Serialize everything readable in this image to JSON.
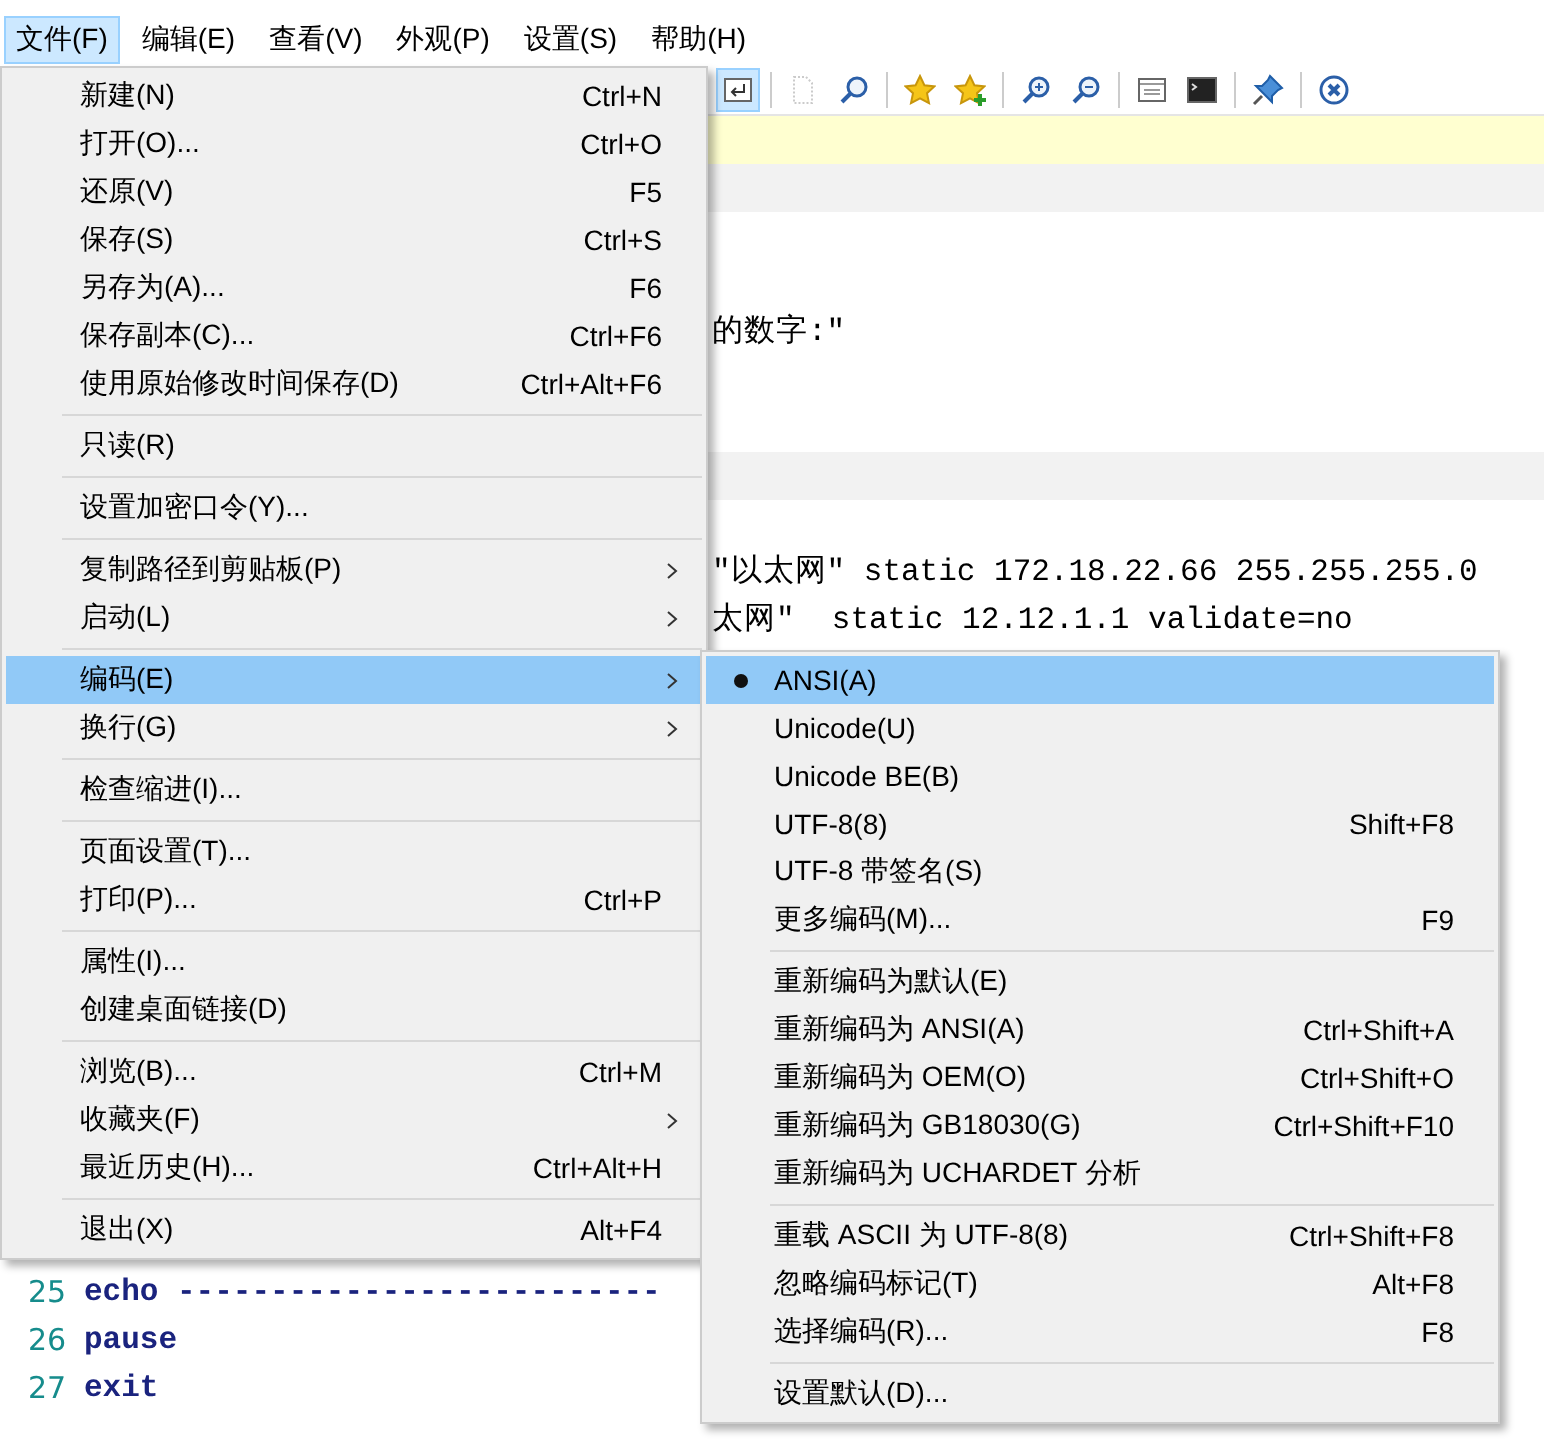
{
  "menubar": [
    {
      "label": "文件(F)",
      "selected": true
    },
    {
      "label": "编辑(E)",
      "selected": false
    },
    {
      "label": "查看(V)",
      "selected": false
    },
    {
      "label": "外观(P)",
      "selected": false
    },
    {
      "label": "设置(S)",
      "selected": false
    },
    {
      "label": "帮助(H)",
      "selected": false
    }
  ],
  "toolbar": [
    {
      "kind": "wrap",
      "pressed": true,
      "disabled": false
    },
    {
      "kind": "sep"
    },
    {
      "kind": "doc",
      "pressed": false,
      "disabled": true
    },
    {
      "kind": "find",
      "pressed": false,
      "disabled": false
    },
    {
      "kind": "sep"
    },
    {
      "kind": "star",
      "pressed": false,
      "disabled": false
    },
    {
      "kind": "star-add",
      "pressed": false,
      "disabled": false
    },
    {
      "kind": "sep"
    },
    {
      "kind": "zoom-in",
      "pressed": false,
      "disabled": false
    },
    {
      "kind": "zoom-out",
      "pressed": false,
      "disabled": false
    },
    {
      "kind": "sep"
    },
    {
      "kind": "window",
      "pressed": false,
      "disabled": false
    },
    {
      "kind": "terminal",
      "pressed": false,
      "disabled": false
    },
    {
      "kind": "sep"
    },
    {
      "kind": "pin",
      "pressed": false,
      "disabled": false
    },
    {
      "kind": "sep"
    },
    {
      "kind": "close",
      "pressed": false,
      "disabled": false
    }
  ],
  "editor": {
    "lines": [
      {
        "kind": "covered",
        "text": "的数字:\""
      },
      {
        "kind": "covered",
        "text": "\"以太网\" static 172.18.22.66 255.255.255.0"
      },
      {
        "kind": "covered",
        "text": "太网\"  static 12.12.1.1 validate=no"
      },
      {
        "kind": "code",
        "number": "25",
        "text": "echo --------------------------"
      },
      {
        "kind": "code",
        "number": "26",
        "text": "pause"
      },
      {
        "kind": "code",
        "number": "27",
        "text": "exit"
      }
    ]
  },
  "file_menu": {
    "groups": [
      [
        {
          "label": "新建(N)",
          "shortcut": "Ctrl+N",
          "submenu": false,
          "selected": false
        },
        {
          "label": "打开(O)...",
          "shortcut": "Ctrl+O",
          "submenu": false,
          "selected": false
        },
        {
          "label": "还原(V)",
          "shortcut": "F5",
          "submenu": false,
          "selected": false
        },
        {
          "label": "保存(S)",
          "shortcut": "Ctrl+S",
          "submenu": false,
          "selected": false
        },
        {
          "label": "另存为(A)...",
          "shortcut": "F6",
          "submenu": false,
          "selected": false
        },
        {
          "label": "保存副本(C)...",
          "shortcut": "Ctrl+F6",
          "submenu": false,
          "selected": false
        },
        {
          "label": "使用原始修改时间保存(D)",
          "shortcut": "Ctrl+Alt+F6",
          "submenu": false,
          "selected": false
        }
      ],
      [
        {
          "label": "只读(R)",
          "submenu": false,
          "selected": false
        }
      ],
      [
        {
          "label": "设置加密口令(Y)...",
          "submenu": false,
          "selected": false
        }
      ],
      [
        {
          "label": "复制路径到剪贴板(P)",
          "submenu": true,
          "selected": false
        },
        {
          "label": "启动(L)",
          "submenu": true,
          "selected": false
        }
      ],
      [
        {
          "label": "编码(E)",
          "submenu": true,
          "selected": true
        },
        {
          "label": "换行(G)",
          "submenu": true,
          "selected": false
        }
      ],
      [
        {
          "label": "检查缩进(I)...",
          "submenu": false,
          "selected": false
        }
      ],
      [
        {
          "label": "页面设置(T)...",
          "submenu": false,
          "selected": false
        },
        {
          "label": "打印(P)...",
          "shortcut": "Ctrl+P",
          "submenu": false,
          "selected": false
        }
      ],
      [
        {
          "label": "属性(I)...",
          "submenu": false,
          "selected": false
        },
        {
          "label": "创建桌面链接(D)",
          "submenu": false,
          "selected": false
        }
      ],
      [
        {
          "label": "浏览(B)...",
          "shortcut": "Ctrl+M",
          "submenu": false,
          "selected": false
        },
        {
          "label": "收藏夹(F)",
          "submenu": true,
          "selected": false
        },
        {
          "label": "最近历史(H)...",
          "shortcut": "Ctrl+Alt+H",
          "submenu": false,
          "selected": false
        }
      ],
      [
        {
          "label": "退出(X)",
          "shortcut": "Alt+F4",
          "submenu": false,
          "selected": false
        }
      ]
    ]
  },
  "encoding_menu": {
    "groups": [
      [
        {
          "label": "ANSI(A)",
          "checked": true,
          "selected": true
        },
        {
          "label": "Unicode(U)",
          "checked": false,
          "selected": false
        },
        {
          "label": "Unicode BE(B)",
          "checked": false,
          "selected": false
        },
        {
          "label": "UTF-8(8)",
          "shortcut": "Shift+F8",
          "checked": false,
          "selected": false
        },
        {
          "label": "UTF-8 带签名(S)",
          "checked": false,
          "selected": false
        },
        {
          "label": "更多编码(M)...",
          "shortcut": "F9",
          "checked": false,
          "selected": false
        }
      ],
      [
        {
          "label": "重新编码为默认(E)",
          "checked": false,
          "selected": false
        },
        {
          "label": "重新编码为 ANSI(A)",
          "shortcut": "Ctrl+Shift+A",
          "checked": false,
          "selected": false
        },
        {
          "label": "重新编码为 OEM(O)",
          "shortcut": "Ctrl+Shift+O",
          "checked": false,
          "selected": false
        },
        {
          "label": "重新编码为 GB18030(G)",
          "shortcut": "Ctrl+Shift+F10",
          "checked": false,
          "selected": false
        },
        {
          "label": "重新编码为 UCHARDET 分析",
          "checked": false,
          "selected": false
        }
      ],
      [
        {
          "label": "重载 ASCII 为 UTF-8(8)",
          "shortcut": "Ctrl+Shift+F8",
          "checked": false,
          "selected": false
        },
        {
          "label": "忽略编码标记(T)",
          "shortcut": "Alt+F8",
          "checked": false,
          "selected": false
        },
        {
          "label": "选择编码(R)...",
          "shortcut": "F8",
          "checked": false,
          "selected": false
        }
      ],
      [
        {
          "label": "设置默认(D)...",
          "checked": false,
          "selected": false
        }
      ]
    ]
  }
}
